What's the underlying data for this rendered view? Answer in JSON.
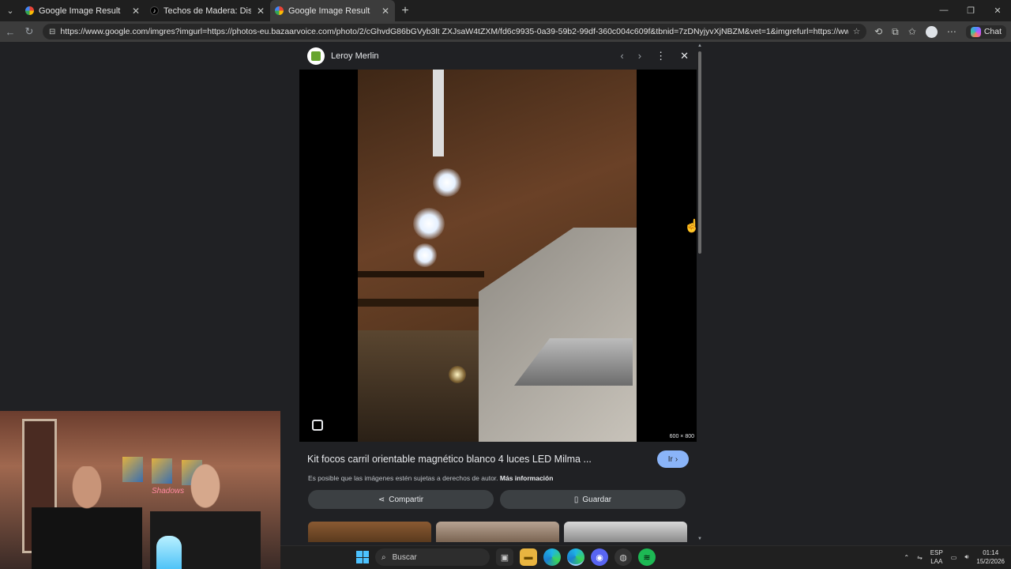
{
  "browser": {
    "tabs": [
      {
        "title": "Google Image Result",
        "favicon": "google-icon",
        "active": false
      },
      {
        "title": "Techos de Madera: Diseños Mode",
        "favicon": "tiktok-icon",
        "active": false
      },
      {
        "title": "Google Image Result",
        "favicon": "google-icon",
        "active": true
      }
    ],
    "url": "https://www.google.com/imgres?imgurl=https://photos-eu.bazaarvoice.com/photo/2/cGhvdG86bGVyb3lt ZXJsaW4tZXM/fd6c9935-0a39-59b2-99df-360c004c609f&tbnid=7zDNyjyvXjNBZM&vet=1&imgrefurl=https://www.leroymerlin.es/produc...",
    "chat_label": "Chat"
  },
  "viewer": {
    "site_name": "Leroy Merlin",
    "image_dims": "600 × 800",
    "caption": "Kit focos carril orientable magnético blanco 4 luces LED Milma ...",
    "go_label": "Ir",
    "rights_text": "Es posible que las imágenes estén sujetas a derechos de autor.",
    "rights_link": "Más información",
    "share_label": "Compartir",
    "save_label": "Guardar"
  },
  "taskbar": {
    "search_placeholder": "Buscar",
    "lang_line1": "ESP",
    "lang_line2": "LAA",
    "time": "01:14",
    "date": "15/2/2026"
  },
  "webcam": {
    "neon_sign": "Shadows"
  },
  "colors": {
    "accent_blue": "#8ab4f8",
    "page_bg": "#202124",
    "button_bg": "#3c4043"
  }
}
